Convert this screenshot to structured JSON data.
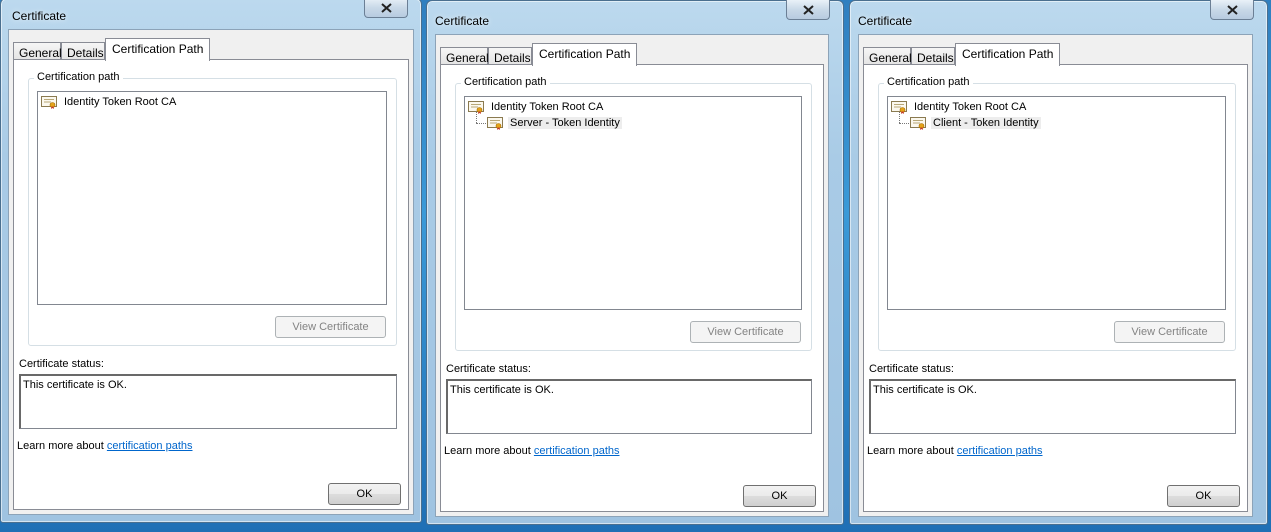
{
  "dialogs": [
    {
      "title": "Certificate",
      "tabs": [
        "General",
        "Details",
        "Certification Path"
      ],
      "active_tab": "Certification Path",
      "group_label": "Certification path",
      "nodes": [
        {
          "label": "Identity Token Root CA",
          "level": 0,
          "selected": false
        }
      ],
      "view_button": "View Certificate",
      "status_label": "Certificate status:",
      "status_text": "This certificate is OK.",
      "learn_prefix": "Learn more about ",
      "learn_link": "certification paths",
      "ok_label": "OK"
    },
    {
      "title": "Certificate",
      "tabs": [
        "General",
        "Details",
        "Certification Path"
      ],
      "active_tab": "Certification Path",
      "group_label": "Certification path",
      "nodes": [
        {
          "label": "Identity Token Root CA",
          "level": 0,
          "selected": false
        },
        {
          "label": "Server - Token Identity",
          "level": 1,
          "selected": true
        }
      ],
      "view_button": "View Certificate",
      "status_label": "Certificate status:",
      "status_text": "This certificate is OK.",
      "learn_prefix": "Learn more about ",
      "learn_link": "certification paths",
      "ok_label": "OK"
    },
    {
      "title": "Certificate",
      "tabs": [
        "General",
        "Details",
        "Certification Path"
      ],
      "active_tab": "Certification Path",
      "group_label": "Certification path",
      "nodes": [
        {
          "label": "Identity Token Root CA",
          "level": 0,
          "selected": false
        },
        {
          "label": "Client - Token Identity",
          "level": 1,
          "selected": true
        }
      ],
      "view_button": "View Certificate",
      "status_label": "Certificate status:",
      "status_text": "This certificate is OK.",
      "learn_prefix": "Learn more about ",
      "learn_link": "certification paths",
      "ok_label": "OK"
    }
  ],
  "icons": {
    "close": "close-icon",
    "certificate": "certificate-icon"
  },
  "colors": {
    "link": "#0066cc",
    "accent": "#3b9ad8"
  }
}
